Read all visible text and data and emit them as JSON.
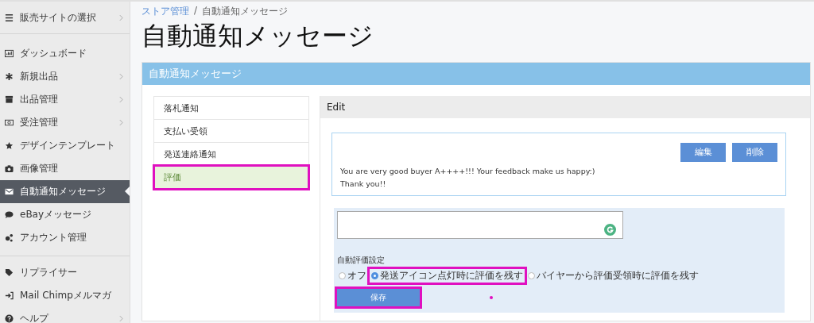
{
  "sidebar": {
    "site_selector": {
      "label": "販売サイトの選択",
      "has_arrow": true
    },
    "groups": [
      [
        {
          "label": "ダッシュボード",
          "has_arrow": false,
          "selected": false
        },
        {
          "label": "新規出品",
          "has_arrow": true,
          "selected": false
        },
        {
          "label": "出品管理",
          "has_arrow": true,
          "selected": false
        },
        {
          "label": "受注管理",
          "has_arrow": true,
          "selected": false
        },
        {
          "label": "デザインテンプレート",
          "has_arrow": false,
          "selected": false
        },
        {
          "label": "画像管理",
          "has_arrow": false,
          "selected": false
        },
        {
          "label": "自動通知メッセージ",
          "has_arrow": false,
          "selected": true
        },
        {
          "label": "eBayメッセージ",
          "has_arrow": false,
          "selected": false
        },
        {
          "label": "アカウント管理",
          "has_arrow": false,
          "selected": false
        }
      ],
      [
        {
          "label": "リプライサー",
          "has_arrow": false,
          "selected": false
        },
        {
          "label": "Mail Chimpメルマガ",
          "has_arrow": false,
          "selected": false
        },
        {
          "label": "ヘルプ",
          "has_arrow": true,
          "selected": false
        }
      ]
    ]
  },
  "breadcrumb": {
    "separator": "/",
    "items": [
      {
        "label": "ストア管理",
        "link": true
      },
      {
        "label": "自動通知メッセージ",
        "link": false
      }
    ]
  },
  "page_title": "自動通知メッセージ",
  "panel": {
    "title": "自動通知メッセージ",
    "tabs": [
      {
        "label": "落札通知",
        "selected": false,
        "highlighted": false
      },
      {
        "label": "支払い受領",
        "selected": false,
        "highlighted": false
      },
      {
        "label": "発送連絡通知",
        "selected": false,
        "highlighted": false
      },
      {
        "label": "評価",
        "selected": true,
        "highlighted": true
      }
    ],
    "edit": {
      "title": "Edit",
      "message": {
        "buttons": [
          "編集",
          "削除"
        ],
        "lines": [
          "You are very good buyer A++++!!! Your feedback make us happy:)",
          "Thank you!!"
        ]
      },
      "form": {
        "label": "自動評価設定",
        "options": [
          {
            "label": "オフ",
            "selected": false,
            "highlighted": false
          },
          {
            "label": "発送アイコン点灯時に評価を残す",
            "selected": true,
            "highlighted": true
          },
          {
            "label": "バイヤーから評価受領時に評価を残す",
            "selected": false,
            "highlighted": false
          }
        ],
        "save": {
          "label": "保存",
          "highlighted": true
        },
        "annotation_dot": true
      }
    }
  }
}
